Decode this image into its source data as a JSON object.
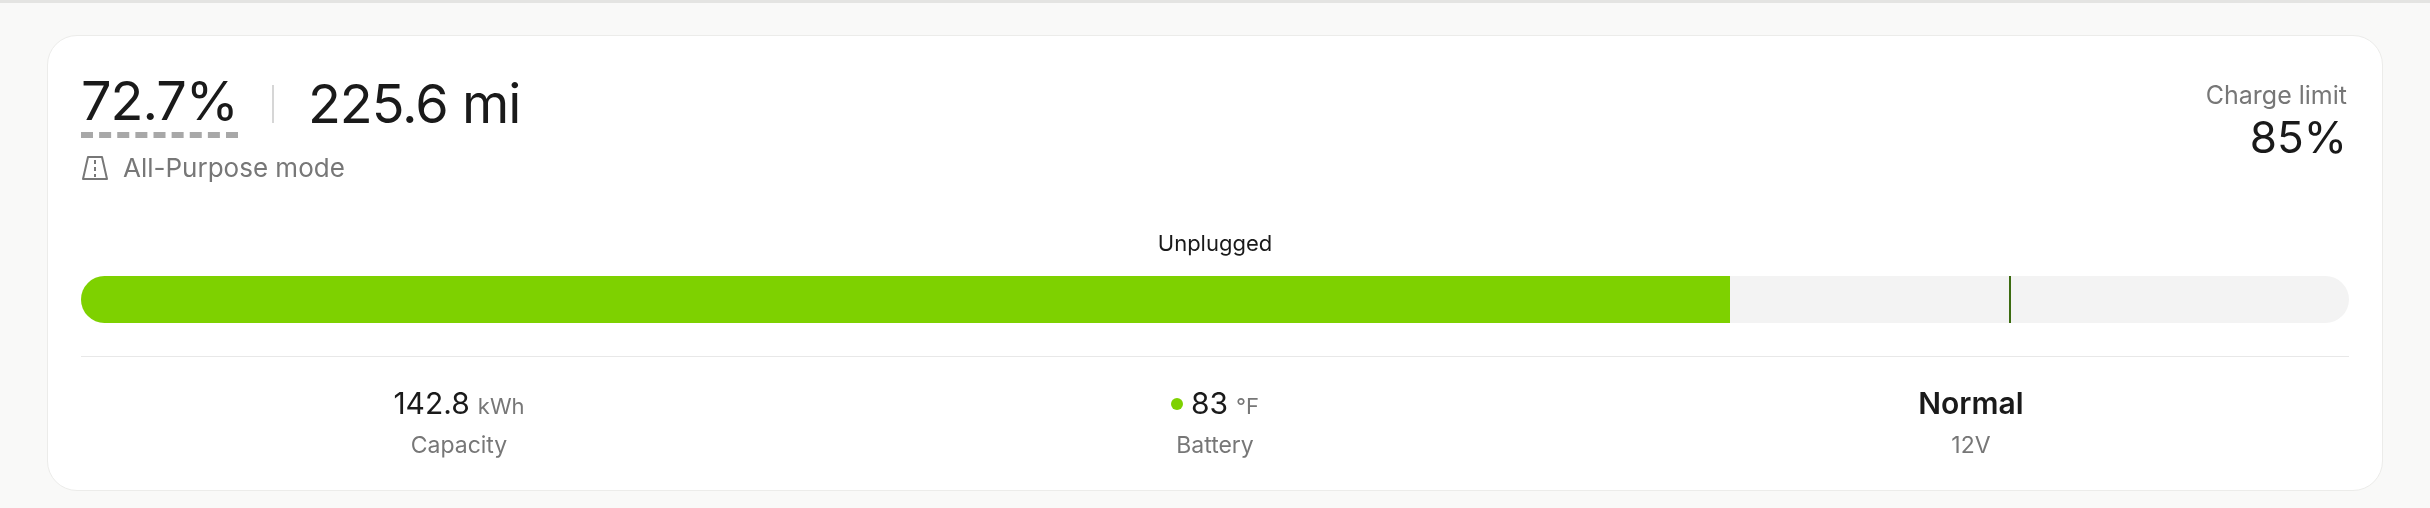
{
  "summary": {
    "charge": "72.7%",
    "range": "225.6 mi",
    "mode": "All-Purpose mode"
  },
  "charge_limit": {
    "label": "Charge limit",
    "value": "85%",
    "level": 0.85
  },
  "status": "Unplugged",
  "battery_bar": {
    "level": 0.727
  },
  "stats": [
    {
      "value": "142.8",
      "unit": "kWh",
      "label": "Capacity"
    },
    {
      "value": "83",
      "unit": "°F",
      "label": "Battery",
      "color": "#7ed100"
    },
    {
      "value": "Normal",
      "label": "12V",
      "bold": true
    }
  ]
}
